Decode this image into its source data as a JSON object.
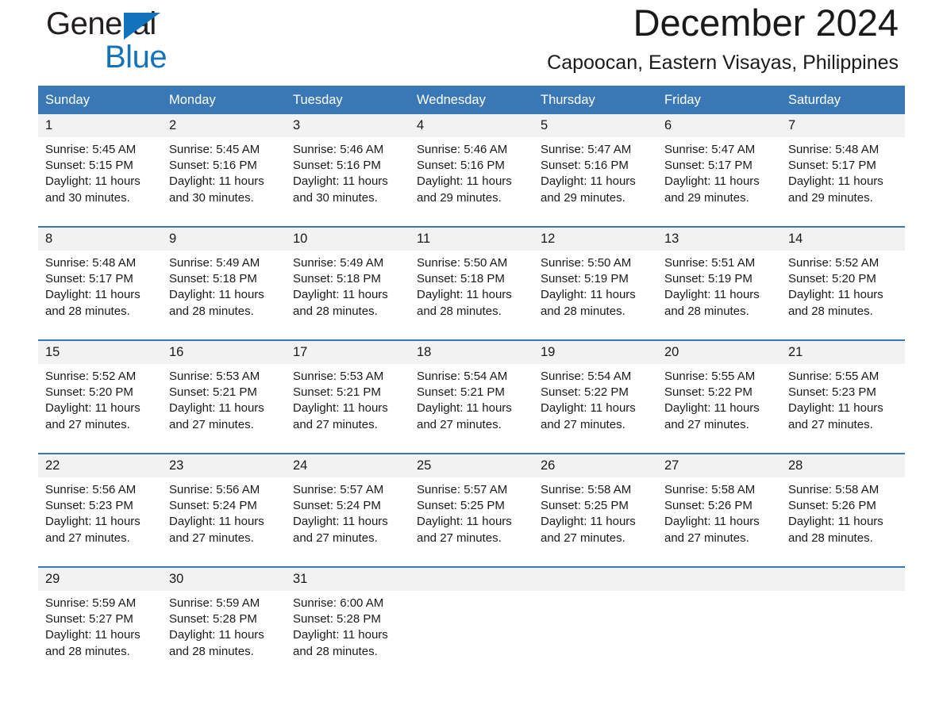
{
  "logo": {
    "word_one": "General",
    "word_two": "Blue",
    "triangle_color": "#1272bb"
  },
  "header": {
    "month_title": "December 2024",
    "location": "Capoocan, Eastern Visayas, Philippines"
  },
  "theme": {
    "header_blue": "#3a78b5",
    "daynum_band": "#f2f2f2",
    "text": "#1a1a1a",
    "logo_blue": "#1272bb"
  },
  "calendar": {
    "weekday_headers": [
      "Sunday",
      "Monday",
      "Tuesday",
      "Wednesday",
      "Thursday",
      "Friday",
      "Saturday"
    ],
    "weeks": [
      {
        "days": [
          {
            "date": "1",
            "sunrise": "Sunrise: 5:45 AM",
            "sunset": "Sunset: 5:15 PM",
            "daylight": "Daylight: 11 hours and 30 minutes."
          },
          {
            "date": "2",
            "sunrise": "Sunrise: 5:45 AM",
            "sunset": "Sunset: 5:16 PM",
            "daylight": "Daylight: 11 hours and 30 minutes."
          },
          {
            "date": "3",
            "sunrise": "Sunrise: 5:46 AM",
            "sunset": "Sunset: 5:16 PM",
            "daylight": "Daylight: 11 hours and 30 minutes."
          },
          {
            "date": "4",
            "sunrise": "Sunrise: 5:46 AM",
            "sunset": "Sunset: 5:16 PM",
            "daylight": "Daylight: 11 hours and 29 minutes."
          },
          {
            "date": "5",
            "sunrise": "Sunrise: 5:47 AM",
            "sunset": "Sunset: 5:16 PM",
            "daylight": "Daylight: 11 hours and 29 minutes."
          },
          {
            "date": "6",
            "sunrise": "Sunrise: 5:47 AM",
            "sunset": "Sunset: 5:17 PM",
            "daylight": "Daylight: 11 hours and 29 minutes."
          },
          {
            "date": "7",
            "sunrise": "Sunrise: 5:48 AM",
            "sunset": "Sunset: 5:17 PM",
            "daylight": "Daylight: 11 hours and 29 minutes."
          }
        ]
      },
      {
        "days": [
          {
            "date": "8",
            "sunrise": "Sunrise: 5:48 AM",
            "sunset": "Sunset: 5:17 PM",
            "daylight": "Daylight: 11 hours and 28 minutes."
          },
          {
            "date": "9",
            "sunrise": "Sunrise: 5:49 AM",
            "sunset": "Sunset: 5:18 PM",
            "daylight": "Daylight: 11 hours and 28 minutes."
          },
          {
            "date": "10",
            "sunrise": "Sunrise: 5:49 AM",
            "sunset": "Sunset: 5:18 PM",
            "daylight": "Daylight: 11 hours and 28 minutes."
          },
          {
            "date": "11",
            "sunrise": "Sunrise: 5:50 AM",
            "sunset": "Sunset: 5:18 PM",
            "daylight": "Daylight: 11 hours and 28 minutes."
          },
          {
            "date": "12",
            "sunrise": "Sunrise: 5:50 AM",
            "sunset": "Sunset: 5:19 PM",
            "daylight": "Daylight: 11 hours and 28 minutes."
          },
          {
            "date": "13",
            "sunrise": "Sunrise: 5:51 AM",
            "sunset": "Sunset: 5:19 PM",
            "daylight": "Daylight: 11 hours and 28 minutes."
          },
          {
            "date": "14",
            "sunrise": "Sunrise: 5:52 AM",
            "sunset": "Sunset: 5:20 PM",
            "daylight": "Daylight: 11 hours and 28 minutes."
          }
        ]
      },
      {
        "days": [
          {
            "date": "15",
            "sunrise": "Sunrise: 5:52 AM",
            "sunset": "Sunset: 5:20 PM",
            "daylight": "Daylight: 11 hours and 27 minutes."
          },
          {
            "date": "16",
            "sunrise": "Sunrise: 5:53 AM",
            "sunset": "Sunset: 5:21 PM",
            "daylight": "Daylight: 11 hours and 27 minutes."
          },
          {
            "date": "17",
            "sunrise": "Sunrise: 5:53 AM",
            "sunset": "Sunset: 5:21 PM",
            "daylight": "Daylight: 11 hours and 27 minutes."
          },
          {
            "date": "18",
            "sunrise": "Sunrise: 5:54 AM",
            "sunset": "Sunset: 5:21 PM",
            "daylight": "Daylight: 11 hours and 27 minutes."
          },
          {
            "date": "19",
            "sunrise": "Sunrise: 5:54 AM",
            "sunset": "Sunset: 5:22 PM",
            "daylight": "Daylight: 11 hours and 27 minutes."
          },
          {
            "date": "20",
            "sunrise": "Sunrise: 5:55 AM",
            "sunset": "Sunset: 5:22 PM",
            "daylight": "Daylight: 11 hours and 27 minutes."
          },
          {
            "date": "21",
            "sunrise": "Sunrise: 5:55 AM",
            "sunset": "Sunset: 5:23 PM",
            "daylight": "Daylight: 11 hours and 27 minutes."
          }
        ]
      },
      {
        "days": [
          {
            "date": "22",
            "sunrise": "Sunrise: 5:56 AM",
            "sunset": "Sunset: 5:23 PM",
            "daylight": "Daylight: 11 hours and 27 minutes."
          },
          {
            "date": "23",
            "sunrise": "Sunrise: 5:56 AM",
            "sunset": "Sunset: 5:24 PM",
            "daylight": "Daylight: 11 hours and 27 minutes."
          },
          {
            "date": "24",
            "sunrise": "Sunrise: 5:57 AM",
            "sunset": "Sunset: 5:24 PM",
            "daylight": "Daylight: 11 hours and 27 minutes."
          },
          {
            "date": "25",
            "sunrise": "Sunrise: 5:57 AM",
            "sunset": "Sunset: 5:25 PM",
            "daylight": "Daylight: 11 hours and 27 minutes."
          },
          {
            "date": "26",
            "sunrise": "Sunrise: 5:58 AM",
            "sunset": "Sunset: 5:25 PM",
            "daylight": "Daylight: 11 hours and 27 minutes."
          },
          {
            "date": "27",
            "sunrise": "Sunrise: 5:58 AM",
            "sunset": "Sunset: 5:26 PM",
            "daylight": "Daylight: 11 hours and 27 minutes."
          },
          {
            "date": "28",
            "sunrise": "Sunrise: 5:58 AM",
            "sunset": "Sunset: 5:26 PM",
            "daylight": "Daylight: 11 hours and 28 minutes."
          }
        ]
      },
      {
        "days": [
          {
            "date": "29",
            "sunrise": "Sunrise: 5:59 AM",
            "sunset": "Sunset: 5:27 PM",
            "daylight": "Daylight: 11 hours and 28 minutes."
          },
          {
            "date": "30",
            "sunrise": "Sunrise: 5:59 AM",
            "sunset": "Sunset: 5:28 PM",
            "daylight": "Daylight: 11 hours and 28 minutes."
          },
          {
            "date": "31",
            "sunrise": "Sunrise: 6:00 AM",
            "sunset": "Sunset: 5:28 PM",
            "daylight": "Daylight: 11 hours and 28 minutes."
          },
          {
            "date": "",
            "sunrise": "",
            "sunset": "",
            "daylight": ""
          },
          {
            "date": "",
            "sunrise": "",
            "sunset": "",
            "daylight": ""
          },
          {
            "date": "",
            "sunrise": "",
            "sunset": "",
            "daylight": ""
          },
          {
            "date": "",
            "sunrise": "",
            "sunset": "",
            "daylight": ""
          }
        ]
      }
    ]
  }
}
